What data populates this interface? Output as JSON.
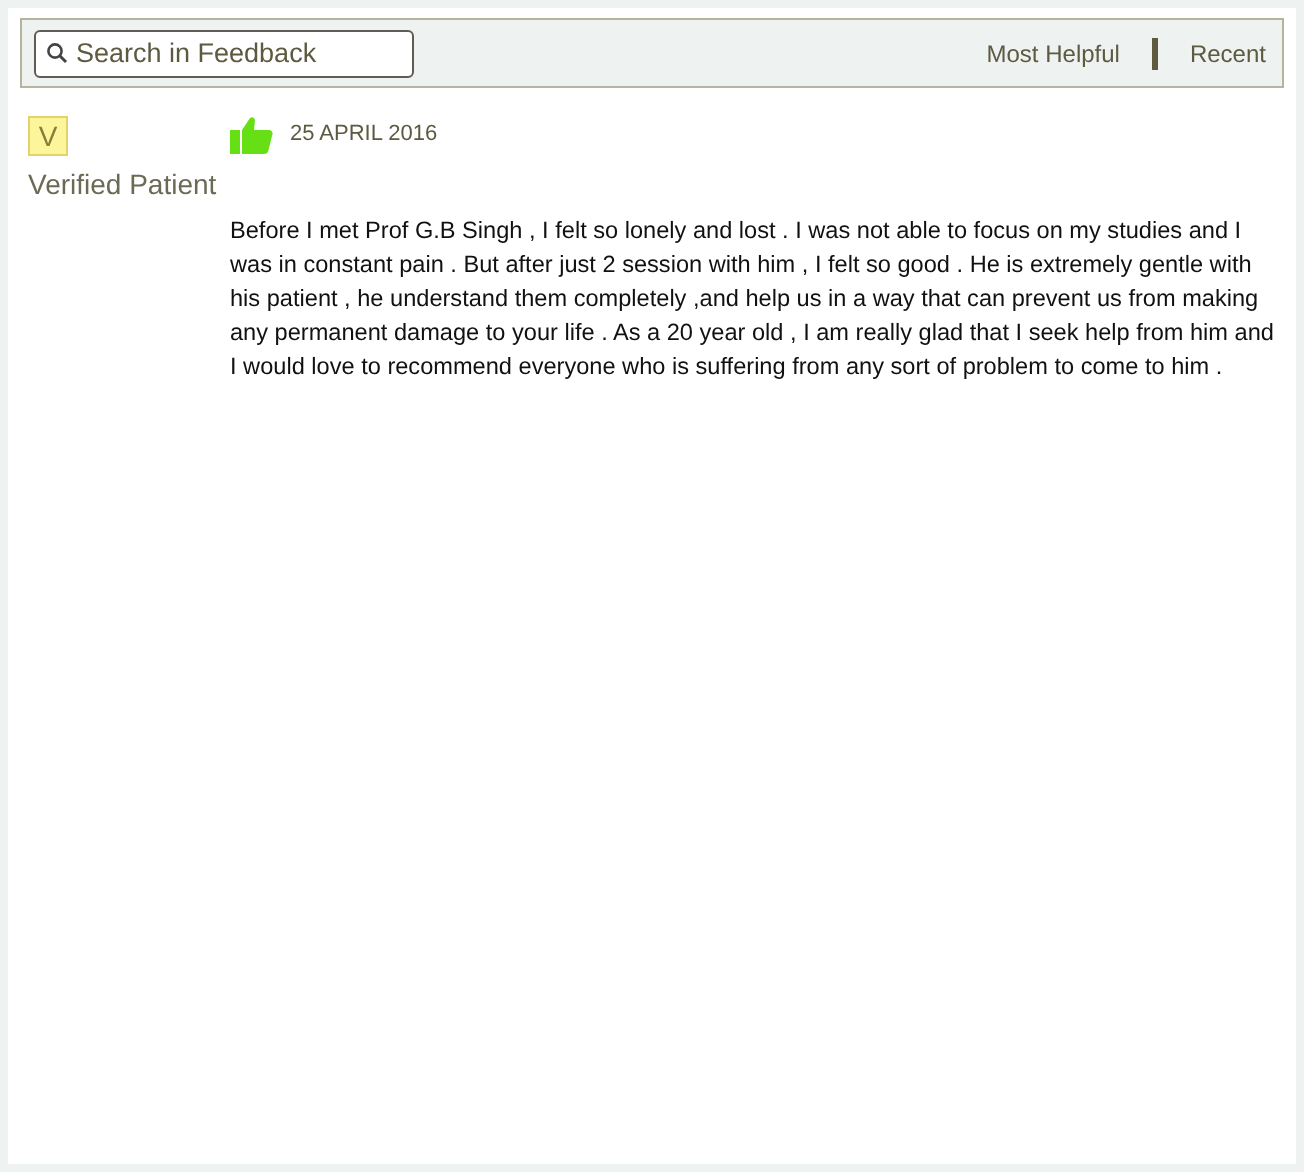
{
  "search": {
    "placeholder": "Search in Feedback"
  },
  "sort_options": [
    {
      "label": "Most Helpful"
    },
    {
      "label": "Recent"
    }
  ],
  "review": {
    "avatar_letter": "V",
    "author": "Verified Patient",
    "date": "25 APRIL 2016",
    "text": "Before I met Prof G.B Singh , I felt so lonely and lost . I was not able to focus on my studies and I was in constant pain . But after just 2 session with him , I felt so good . He is extremely gentle with his patient , he understand them completely ,and help us in a way that can prevent us from making any permanent damage to your life . As a 20 year old , I am really glad that I seek help from him and I would love to recommend everyone who is suffering from any sort of problem to come to him ."
  }
}
